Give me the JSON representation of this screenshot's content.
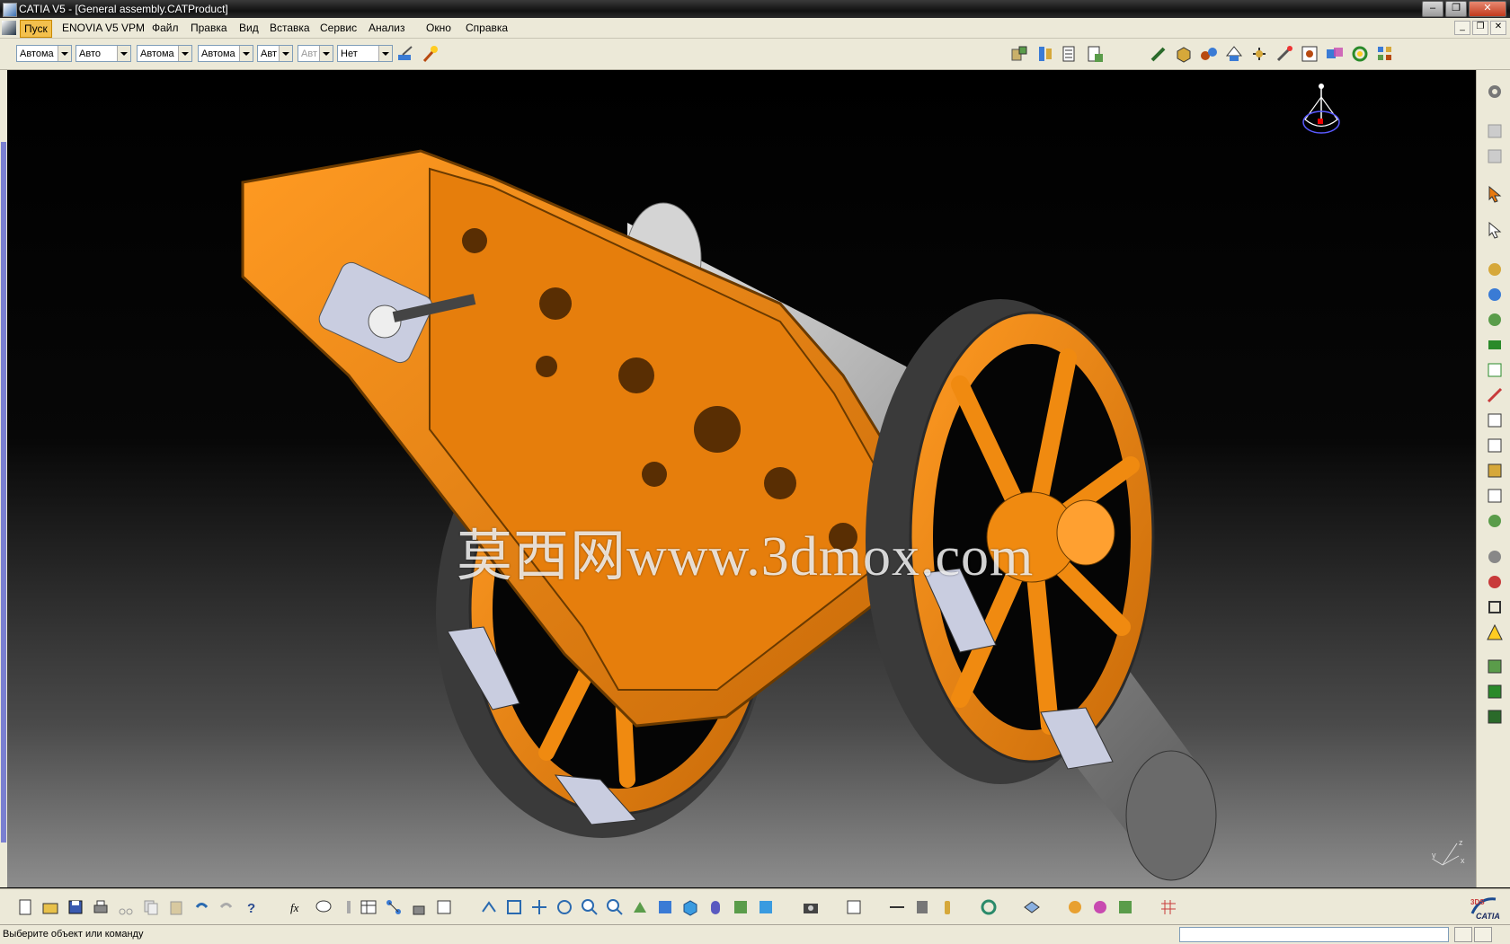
{
  "titlebar": {
    "title": "CATIA V5 - [General assembly.CATProduct]"
  },
  "menu": {
    "items": [
      {
        "label": "Пуск",
        "active": true
      },
      {
        "label": "ENOVIA V5 VPM"
      },
      {
        "label": "Файл"
      },
      {
        "label": "Правка"
      },
      {
        "label": "Вид"
      },
      {
        "label": "Вставка"
      },
      {
        "label": "Сервис"
      },
      {
        "label": "Анализ"
      },
      {
        "label": "Окно"
      },
      {
        "label": "Справка"
      }
    ]
  },
  "toolbar": {
    "combos": [
      {
        "value": "Автома"
      },
      {
        "value": "Авто"
      },
      {
        "value": "Автома"
      },
      {
        "value": "Автома"
      },
      {
        "value": "Авт"
      },
      {
        "value": "Авт",
        "disabled": true
      },
      {
        "value": "Нет"
      }
    ]
  },
  "watermark": {
    "text": "莫西网www.3dmox.com"
  },
  "compass": {
    "axis_label": "z"
  },
  "axis_triad": {
    "x": "x",
    "y": "y",
    "z": "z"
  },
  "brand": {
    "logo_text": "CATIA",
    "logo_prefix": "3DS"
  },
  "status": {
    "message": "Выберите объект или команду"
  },
  "colors": {
    "chrome": "#ece9d8",
    "model_orange": "#f08a10",
    "model_grey": "#8e8e8e",
    "menu_active": "#f3c04d"
  }
}
